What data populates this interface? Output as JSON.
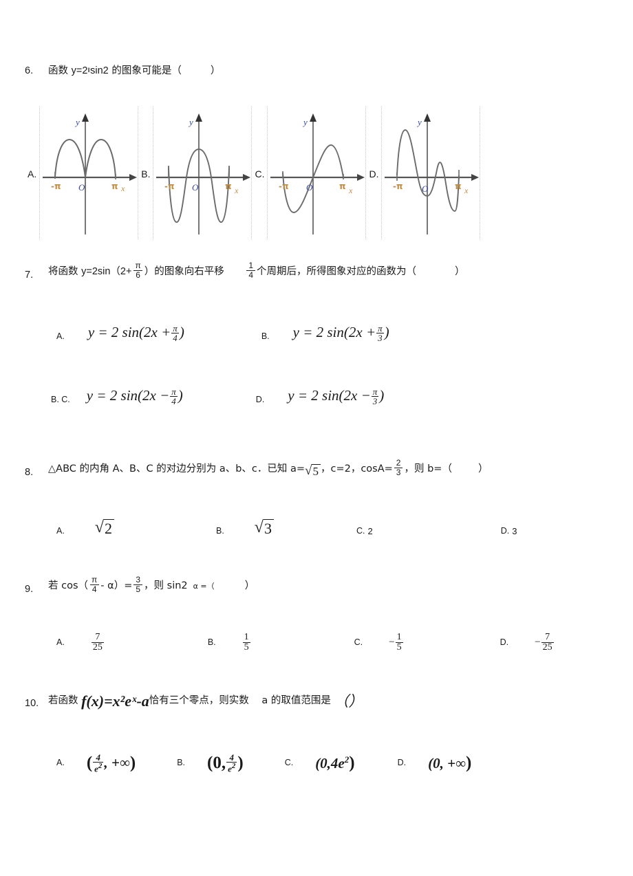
{
  "document": {
    "type": "math-exam-page",
    "language": "zh-CN"
  },
  "questions": [
    {
      "number": "6.",
      "stem_prefix": "函数 ",
      "stem_expr": "y=2",
      "stem_expr_sup": "‖",
      "stem_expr_tail": "sin2",
      "stem_suffix": " 的图象可能是（",
      "stem_close": "）",
      "options": [
        {
          "label": "A.",
          "graph": "two-humps-above-axis"
        },
        {
          "label": "B.",
          "graph": "even-oscillating-deep-lobes"
        },
        {
          "label": "C.",
          "graph": "odd-single-trough-peak"
        },
        {
          "label": "D.",
          "graph": "decaying-amplitude-oscillation"
        }
      ],
      "axis_labels": {
        "y": "y",
        "x": "x",
        "origin": "O",
        "left_tick": "-π",
        "right_tick": "π"
      }
    },
    {
      "number": "7.",
      "stem_a": "将函数 ",
      "stem_b": "y=2sin（2+",
      "frac_num": "π",
      "frac_den": "6",
      "stem_c": "）的图象向右平移 ",
      "frac2_num": "1",
      "frac2_den": "4",
      "stem_d": "个周期后，所得图象对应的函数为（",
      "stem_e": "）",
      "options": [
        {
          "label": "A.",
          "lhs": "y = 2 sin(2x +",
          "fnum": "π",
          "fden": "4",
          "rhs": ")"
        },
        {
          "label": "B.",
          "lhs": "y = 2 sin(2x +",
          "fnum": "π",
          "fden": "3",
          "rhs": ")"
        },
        {
          "label": "B. C.",
          "lhs": "y = 2 sin(2x −",
          "fnum": "π",
          "fden": "4",
          "rhs": ")"
        },
        {
          "label": "D.",
          "lhs": "y = 2 sin(2x −",
          "fnum": "π",
          "fden": "3",
          "rhs": ")"
        }
      ]
    },
    {
      "number": "8.",
      "stem_a": "△ABC 的内角 A、B、C 的对边分别为 a、b、c．已知 a=",
      "sqrt_a": "5",
      "stem_b": "，c=2，cosA=",
      "frac_num": "2",
      "frac_den": "3",
      "stem_c": "，则 b=（",
      "stem_d": "）",
      "options": [
        {
          "label": "A.",
          "kind": "sqrt",
          "value": "2"
        },
        {
          "label": "B.",
          "kind": "sqrt",
          "value": "3"
        },
        {
          "label": "C.",
          "kind": "plain",
          "value": "2"
        },
        {
          "label": "D.",
          "kind": "plain",
          "value": "3"
        }
      ]
    },
    {
      "number": "9.",
      "stem_a": "若 cos（",
      "frac_num": "π",
      "frac_den": "4",
      "stem_b": "- α）=",
      "frac2_num": "3",
      "frac2_den": "5",
      "stem_c": "，则 sin2",
      "stem_d": "α =（",
      "stem_e": "）",
      "options": [
        {
          "label": "A.",
          "sign": "",
          "num": "7",
          "den": "25"
        },
        {
          "label": "B.",
          "sign": "",
          "num": "1",
          "den": "5"
        },
        {
          "label": "C.",
          "sign": "−",
          "num": "1",
          "den": "5"
        },
        {
          "label": "D.",
          "sign": "−",
          "num": "7",
          "den": "25"
        }
      ]
    },
    {
      "number": "10.",
      "stem_a": "若函数 ",
      "expr": "f(x)=x²eˣ-a",
      "stem_b": "恰有三个零点，则实数 ",
      "stem_c": "a 的取值范围是 ",
      "stem_d": "（）",
      "options": [
        {
          "label": "A.",
          "text_open": "(",
          "fnum": "4",
          "fden": "e",
          "fden_sup": "2",
          "text_mid": ", +∞",
          "text_close": ")"
        },
        {
          "label": "B.",
          "text_open": "(0,",
          "fnum": "4",
          "fden": "e",
          "fden_sup": "2",
          "text_mid": "",
          "text_close": ")"
        },
        {
          "label": "C.",
          "plain": "(0,4e",
          "plain_sup": "2",
          "plain_close": ")"
        },
        {
          "label": "D.",
          "plain": "(0, +∞",
          "plain_sup": "",
          "plain_close": ")"
        }
      ]
    }
  ],
  "colors": {
    "text": "#1a1a1a",
    "axis": "#555555",
    "curve": "#6b6b6b",
    "y_label": "#3b4a9e",
    "x_label": "#c08a3e",
    "origin_label": "#3b4a9e",
    "tick_label": "#c08a3e",
    "panel_border": "#c9c9c9"
  }
}
